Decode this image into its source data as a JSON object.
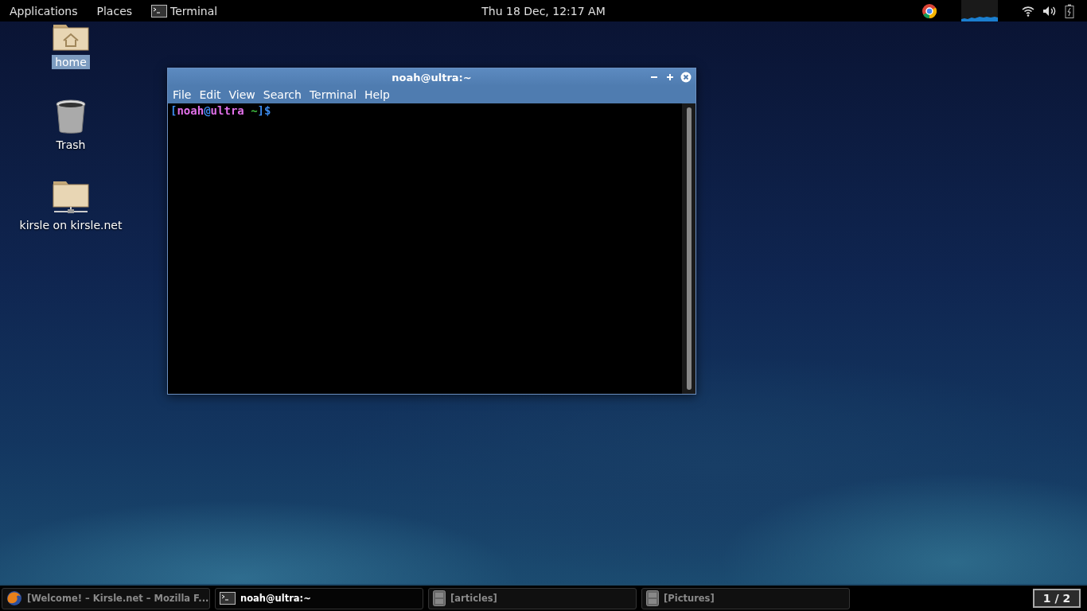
{
  "top_bar": {
    "menus": [
      {
        "label": "Applications"
      },
      {
        "label": "Places"
      }
    ],
    "app": {
      "label": "Terminal"
    },
    "clock": "Thu 18 Dec, 12:17 AM"
  },
  "desktop_icons": [
    {
      "label": "home",
      "kind": "home",
      "selected": true
    },
    {
      "label": "Trash",
      "kind": "trash",
      "selected": false
    },
    {
      "label": "kirsle on kirsle.net",
      "kind": "network",
      "selected": false
    }
  ],
  "terminal": {
    "title": "noah@ultra:~",
    "menu": [
      "File",
      "Edit",
      "View",
      "Search",
      "Terminal",
      "Help"
    ],
    "prompt": [
      {
        "text": "[",
        "color": "#3c8cf0"
      },
      {
        "text": "noah",
        "color": "#e070e8"
      },
      {
        "text": "@",
        "color": "#3c8cf0"
      },
      {
        "text": "ultra ",
        "color": "#e070e8"
      },
      {
        "text": "~",
        "color": "#40c040"
      },
      {
        "text": "]$",
        "color": "#3c8cf0"
      }
    ]
  },
  "taskbar": {
    "items": [
      {
        "label": "[Welcome! – Kirsle.net – Mozilla F...",
        "kind": "browser",
        "selected": false
      },
      {
        "label": "noah@ultra:~",
        "kind": "terminal",
        "selected": true
      },
      {
        "label": "[articles]",
        "kind": "files",
        "selected": false
      },
      {
        "label": "[Pictures]",
        "kind": "files",
        "selected": false
      }
    ],
    "workspace": "1 / 2"
  }
}
